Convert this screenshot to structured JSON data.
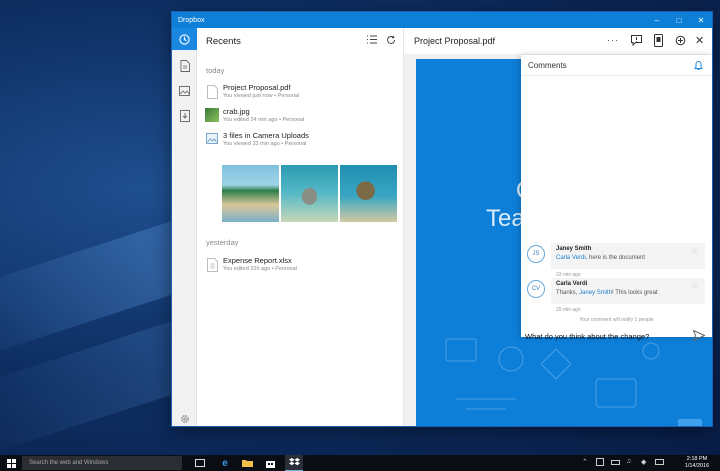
{
  "app": {
    "title": "Dropbox"
  },
  "recents": {
    "header": "Recents",
    "sections": [
      "today",
      "yesterday"
    ],
    "files": [
      {
        "name": "Project Proposal.pdf",
        "meta": "You viewed just now • Personal"
      },
      {
        "name": "crab.jpg",
        "meta": "You edited 24 min ago • Personal"
      },
      {
        "name": "3 files in Camera Uploads",
        "meta": "You viewed 33 min ago • Personal"
      },
      {
        "name": "Expense Report.xlsx",
        "meta": "You edited 22h ago • Personal"
      }
    ]
  },
  "viewer": {
    "title": "Project Proposal.pdf",
    "more": "···",
    "page_text": [
      "Q",
      "Tea"
    ]
  },
  "comments": {
    "header": "Comments",
    "items": [
      {
        "initials": "JS",
        "author": "Janey Smith",
        "mention": "Carla Verdi",
        "text": ", here is the document",
        "time": "33 min ago"
      },
      {
        "initials": "CV",
        "author": "Carla Verdi",
        "text_before": "Thanks, ",
        "mention": "Janey Smith",
        "text": "! This looks great",
        "time": "29 min ago"
      }
    ],
    "notify": "Your comment will notify 1 people",
    "input_value": "What do you think about the change?"
  },
  "taskbar": {
    "search_placeholder": "Search the web and Windows",
    "time": "2:18 PM",
    "date": "1/14/2016"
  },
  "colors": {
    "accent": "#1a87e0",
    "titlebar": "#0e7fd6",
    "doc_blue": "#0d7fd9"
  }
}
